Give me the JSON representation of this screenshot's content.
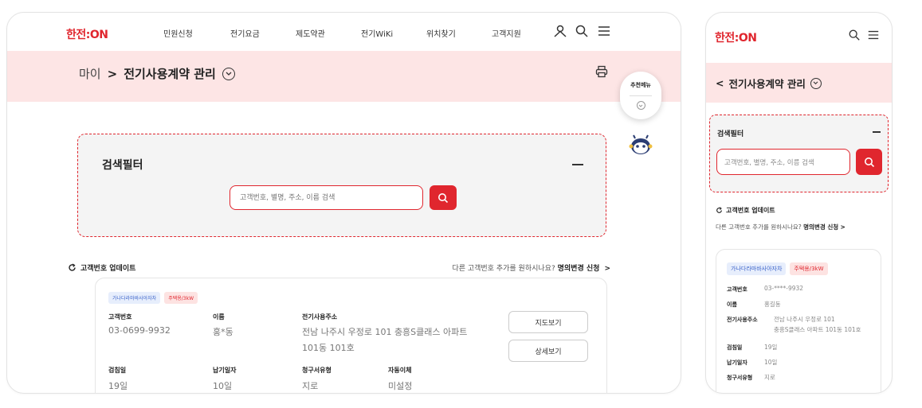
{
  "brand": {
    "logo": "한전:ON",
    "accent": "#e0262e",
    "band": "#fde5e5"
  },
  "desktop": {
    "nav": [
      "민원신청",
      "전기요금",
      "제도약관",
      "전기WiKi",
      "위치찾기",
      "고객지원"
    ],
    "breadcrumb_root": "마이",
    "page_title": "전기사용계약 관리",
    "filter_title": "검색필터",
    "search_placeholder": "고객번호, 별명, 주소, 이름 검색",
    "update_label": "고객번호 업데이트",
    "request_text": "다른 고객번호 추가를 원하시나요?",
    "request_link": "명의변경 신청",
    "card": {
      "tag1": "가나다라마바사아자차",
      "tag2": "주택용/3kW",
      "labels": {
        "customer_no": "고객번호",
        "name": "이름",
        "address": "전기사용주소",
        "meter_day": "검침일",
        "due_day": "납기일자",
        "bill_type": "청구서유형",
        "auto_pay": "자동이체"
      },
      "customer_no": "03-0699-9932",
      "name": "홍*동",
      "address_line1": "전남 나주시 우정로 101 충흥S클래스 아파트",
      "address_line2": "101동 101호",
      "meter_day": "19일",
      "due_day": "10일",
      "bill_type": "지로",
      "auto_pay": "미설정",
      "map_button": "지도보기",
      "detail_button": "상세보기"
    },
    "float_menu": "추천메뉴"
  },
  "mobile": {
    "page_title": "전기사용계약 관리",
    "filter_title": "검색필터",
    "search_placeholder": "고객번호, 별명, 주소, 이름 검색",
    "update_label": "고객번호 업데이트",
    "request_text": "다른 고객번호 추가를 원하시나요?",
    "request_link": "명의변경 신청",
    "card": {
      "tag1": "가나다라마바사아자차",
      "tag2": "주택용/3kW",
      "labels": {
        "customer_no": "고객번호",
        "name": "이름",
        "address": "전기사용주소",
        "meter_day": "검침일",
        "due_day": "납기일자",
        "bill_type": "청구서유형"
      },
      "customer_no": "03-****-9932",
      "name": "홍길동",
      "address_line1": "전남 나주시 우정로 101",
      "address_line2": "충흥S클래스 아파트 101동 101호",
      "meter_day": "19일",
      "due_day": "10일",
      "bill_type": "지로"
    }
  }
}
